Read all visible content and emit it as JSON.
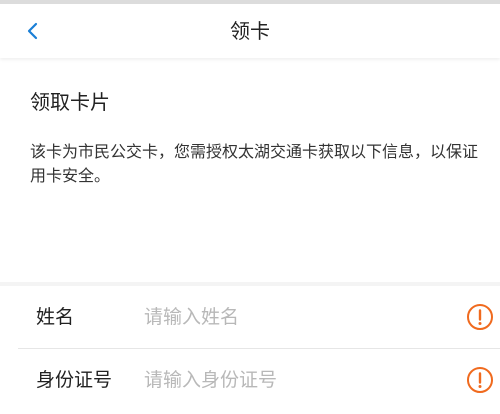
{
  "header": {
    "title": "领卡",
    "back_icon": "chevron-left-icon"
  },
  "card": {
    "title": "领取卡片",
    "description": "该卡为市民公交卡，您需授权太湖交通卡获取以下信息，以保证用卡安全。"
  },
  "form": {
    "fields": [
      {
        "label": "姓名",
        "placeholder": "请输入姓名",
        "value": "",
        "icon": "warning-icon"
      },
      {
        "label": "身份证号",
        "placeholder": "请输入身份证号",
        "value": "",
        "icon": "warning-icon"
      }
    ]
  },
  "colors": {
    "accent": "#1a7fd6",
    "warning": "#f06a1e",
    "placeholder": "#b8b8b8",
    "text": "#222222"
  }
}
